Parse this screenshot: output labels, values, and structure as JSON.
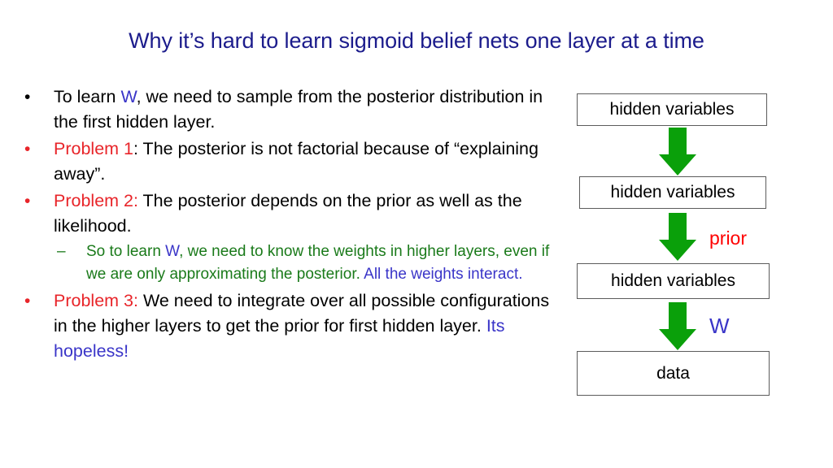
{
  "slide": {
    "title": "Why it’s hard to learn sigmoid belief nets one layer at a time",
    "title_color": "#1c1c8c",
    "background": "#ffffff"
  },
  "palette": {
    "red": "#e8252a",
    "blue": "#3a35c8",
    "green": "#1a7a1a",
    "black": "#000000",
    "arrow_green": "#0aa00a",
    "box_border": "#5c5c5c",
    "prior_red": "#ff0000"
  },
  "bullets": [
    {
      "marker": "•",
      "marker_color": "black",
      "segments": [
        {
          "text": "To learn ",
          "color": "black"
        },
        {
          "text": "W",
          "color": "blue"
        },
        {
          "text": ", we need to sample from the posterior distribution in the first hidden layer.",
          "color": "black"
        }
      ]
    },
    {
      "marker": "•",
      "marker_color": "red",
      "segments": [
        {
          "text": "Problem 1",
          "color": "red"
        },
        {
          "text": ": The posterior is not factorial because of “explaining away”.",
          "color": "black"
        }
      ]
    },
    {
      "marker": "•",
      "marker_color": "red",
      "segments": [
        {
          "text": "Problem 2:",
          "color": "red"
        },
        {
          "text": " The posterior depends on the prior as well as the likelihood.",
          "color": "black"
        }
      ]
    }
  ],
  "sub_bullet": {
    "marker": "–",
    "marker_color": "green",
    "segments": [
      {
        "text": "So to learn ",
        "color": "green"
      },
      {
        "text": "W",
        "color": "blue"
      },
      {
        "text": ", we need to know the weights in higher layers, even if we are only approximating the posterior. ",
        "color": "green"
      },
      {
        "text": "All the weights interact.",
        "color": "blue"
      }
    ]
  },
  "bullet_last": {
    "marker": "•",
    "marker_color": "red",
    "segments": [
      {
        "text": "Problem 3:",
        "color": "red"
      },
      {
        "text": " We need to integrate over all possible configurations in the higher layers to get the prior for first hidden layer. ",
        "color": "black"
      },
      {
        "text": "Its hopeless!",
        "color": "blue"
      }
    ]
  },
  "diagram": {
    "nodes": [
      {
        "label": "hidden variables"
      },
      {
        "label": "hidden variables"
      },
      {
        "label": "hidden variables"
      },
      {
        "label": "data"
      }
    ],
    "edge_labels": {
      "prior": "prior",
      "weights": "W"
    }
  }
}
